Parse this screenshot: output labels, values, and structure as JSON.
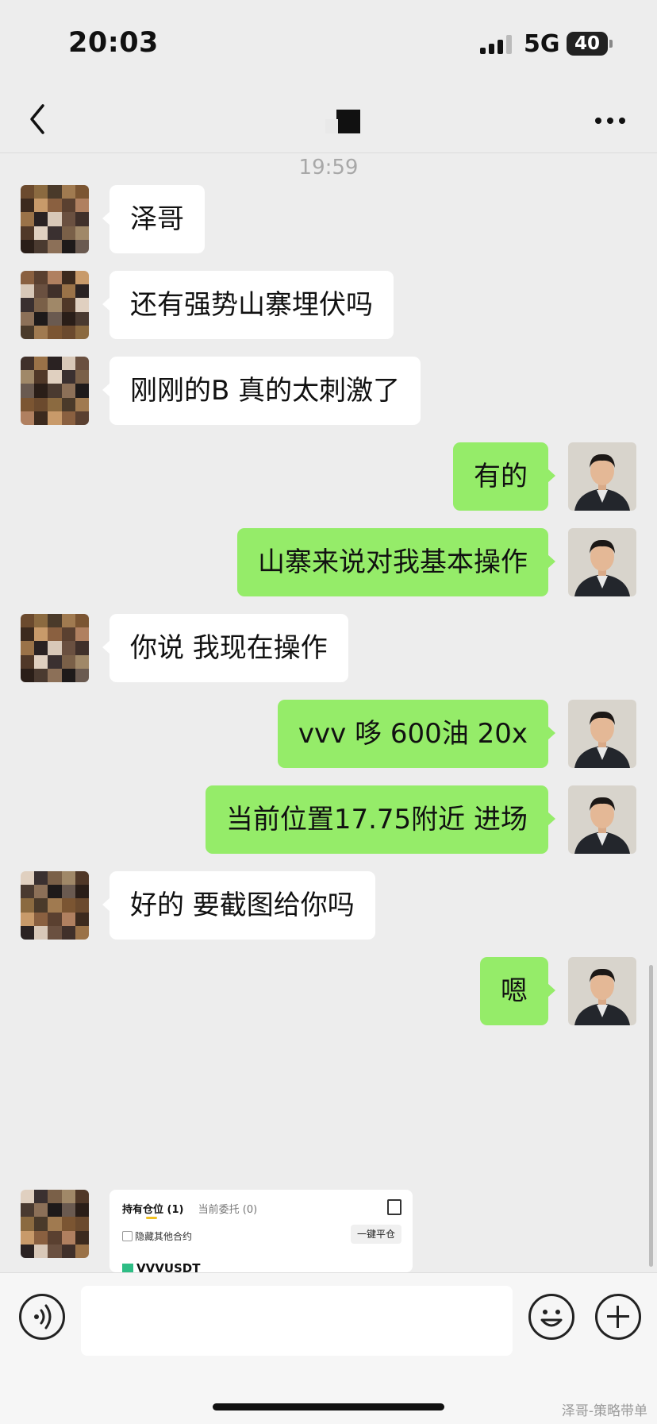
{
  "status_bar": {
    "time": "20:03",
    "network": "5G",
    "battery": "40"
  },
  "nav": {
    "back_icon": "chevron-left-icon",
    "more_icon": "ellipsis-icon"
  },
  "timestamp": "19:59",
  "messages": [
    {
      "side": "in",
      "text": "泽哥"
    },
    {
      "side": "in",
      "text": "还有强势山寨埋伏吗"
    },
    {
      "side": "in",
      "text": "刚刚的B 真的太刺激了"
    },
    {
      "side": "out",
      "text": "有的"
    },
    {
      "side": "out",
      "text": "山寨来说对我基本操作"
    },
    {
      "side": "in",
      "text": "你说 我现在操作"
    },
    {
      "side": "out",
      "text": "vvv 哆  600油 20x"
    },
    {
      "side": "out",
      "text": "当前位置17.75附近 进场"
    },
    {
      "side": "in",
      "text": "好的 要截图给你吗"
    },
    {
      "side": "out",
      "text": "嗯"
    }
  ],
  "screenshot_card": {
    "tab_active": "持有仓位 (1)",
    "tab_inactive": "当前委托 (0)",
    "hide_label": "隐藏其他合约",
    "close_all": "一键平仓",
    "symbol": "VVVUSDT"
  },
  "input_bar": {
    "voice_icon": "voice-icon",
    "emoji_icon": "emoji-icon",
    "plus_icon": "plus-icon"
  },
  "watermark": "泽哥-策略带单",
  "colors": {
    "background": "#ededed",
    "outgoing_bubble": "#95ec69",
    "incoming_bubble": "#ffffff"
  }
}
